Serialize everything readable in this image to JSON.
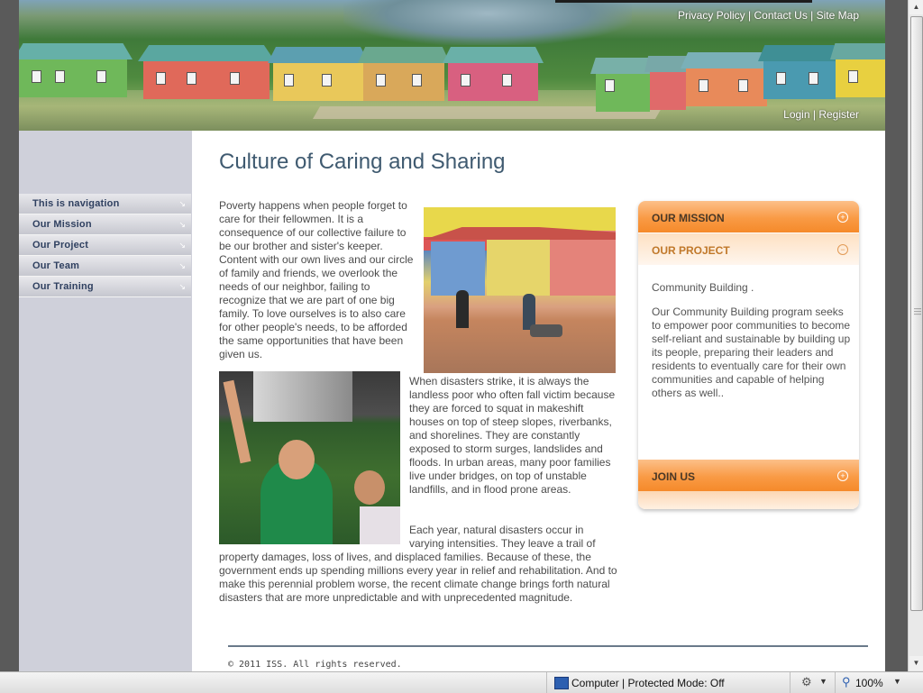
{
  "header": {
    "top_links": [
      "Privacy Policy",
      "Contact Us",
      "Site Map"
    ],
    "account_links": [
      "Login",
      "Register"
    ],
    "separator": " | "
  },
  "sidebar": {
    "items": [
      {
        "label": "This is navigation"
      },
      {
        "label": "Our Mission"
      },
      {
        "label": "Our Project"
      },
      {
        "label": "Our Team"
      },
      {
        "label": "Our Training"
      }
    ]
  },
  "main": {
    "title": "Culture of Caring and Sharing",
    "para1": "Poverty happens when people forget to care for their fellowmen. It is a consequence of our collective failure to be our brother and sister's keeper. Content with our own lives and our circle of family and friends, we overlook the needs of our neighbor, failing to recognize that we are part of one big family. To love ourselves is to also care for other people's needs, to be afforded the same opportunities that have been given us.",
    "para2": "When disasters strike, it is always the landless poor who often fall victim because they are forced to squat in makeshift houses on top of steep slopes, riverbanks, and shorelines. They are constantly exposed to storm surges, landslides and floods. In urban areas, many poor families live under bridges, on top of unstable landfills, and in flood prone areas.",
    "para3_wrap": "Each year, natural disasters occur in varying intensities. They leave a trail of",
    "para3_full": "property damages, loss of lives, and displaced families. Because of these, the government ends up spending millions every year in relief and rehabilitation. And to make this perennial problem worse, the recent climate change brings forth natural disasters that are more unpredictable and with unprecedented magnitude."
  },
  "accordion": {
    "sections": [
      {
        "label": "OUR MISSION",
        "state": "collapsed",
        "icon": "plus-icon"
      },
      {
        "label": "OUR PROJECT",
        "state": "expanded",
        "icon": "minus-icon"
      },
      {
        "label": "JOIN US",
        "state": "collapsed",
        "icon": "plus-icon"
      }
    ],
    "project_heading": "Community Building .",
    "project_text": "Our Community Building program seeks to empower poor communities to become self-reliant and sustainable by building up its people, preparing their leaders and residents to eventually care for their own communities and capable of helping others as well.."
  },
  "footer": {
    "copyright": "© 2011 ISS. All rights reserved."
  },
  "statusbar": {
    "zone": "Computer | Protected Mode: Off",
    "zoom": "100%"
  },
  "colors": {
    "accent_orange": "#f99a45",
    "title_blue": "#3f5a70",
    "nav_text": "#2f4060",
    "sidebar_bg": "#cfd0da"
  }
}
